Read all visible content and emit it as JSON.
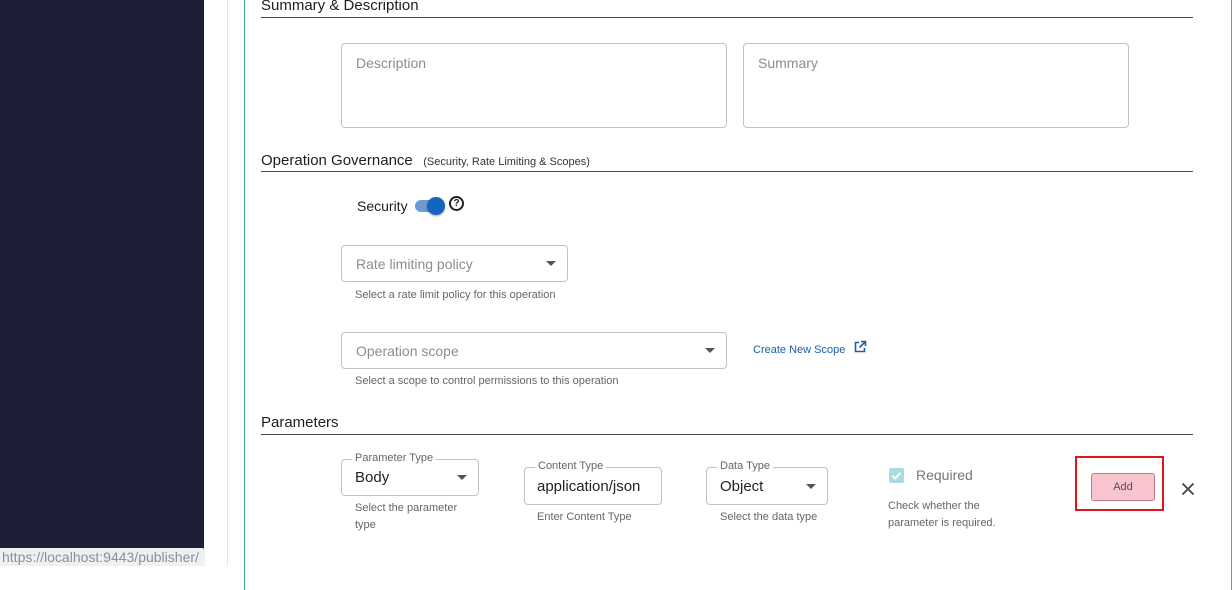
{
  "browser": {
    "status_url": "https://localhost:9443/publisher/"
  },
  "summary_section": {
    "title": "Summary & Description",
    "description_placeholder": "Description",
    "summary_placeholder": "Summary"
  },
  "governance_section": {
    "title": "Operation Governance",
    "subtitle": "(Security, Rate Limiting & Scopes)",
    "security_label": "Security",
    "security_enabled": true,
    "help_icon": "question-circle-icon",
    "rate_limit": {
      "placeholder": "Rate limiting policy",
      "helper": "Select a rate limit policy for this operation"
    },
    "scope": {
      "placeholder": "Operation scope",
      "helper": "Select a scope to control permissions to this operation"
    },
    "create_scope_link": "Create New Scope",
    "external_link_icon": "external-link-icon"
  },
  "parameters_section": {
    "title": "Parameters",
    "parameter_type": {
      "label": "Parameter Type",
      "value": "Body",
      "helper": "Select the parameter type"
    },
    "content_type": {
      "label": "Content Type",
      "value": "application/json",
      "helper": "Enter Content Type"
    },
    "data_type": {
      "label": "Data Type",
      "value": "Object",
      "helper": "Select the data type"
    },
    "required": {
      "label": "Required",
      "checked": true,
      "helper": "Check whether the parameter is required."
    },
    "add_button": "Add",
    "close_icon": "close-icon"
  },
  "colors": {
    "sidebar": "#1f1e37",
    "panel_border": "#3db882",
    "toggle": "#1565c0",
    "link": "#1a5fa8",
    "highlight": "#e0151b",
    "add_button_bg": "#f8c5cf"
  }
}
